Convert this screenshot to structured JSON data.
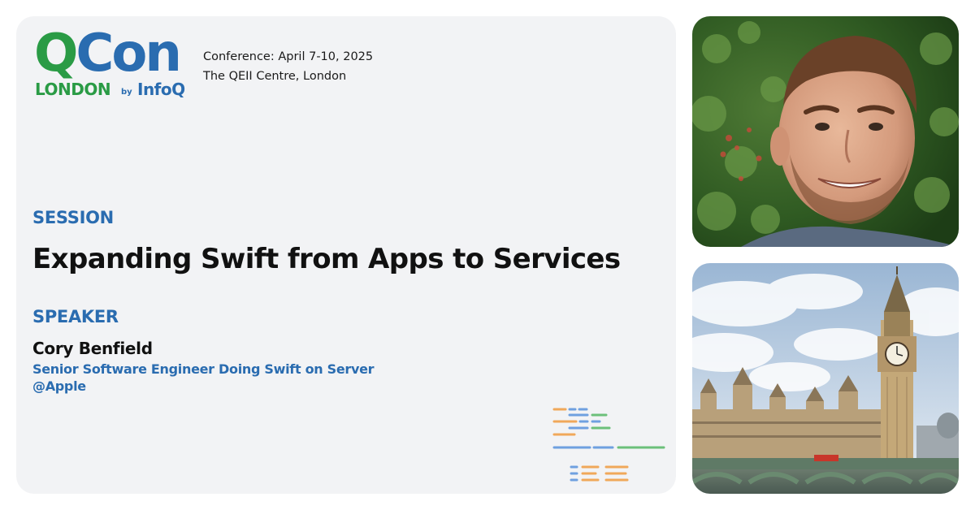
{
  "logo": {
    "q": "Q",
    "con": "Con",
    "city": "LONDON",
    "by": "by",
    "publisher": "InfoQ"
  },
  "conference": {
    "dates": "Conference: April 7-10, 2025",
    "venue": "The QEII Centre, London"
  },
  "session": {
    "label": "SESSION",
    "title": "Expanding Swift from Apps to Services"
  },
  "speaker": {
    "label": "SPEAKER",
    "name": "Cory Benfield",
    "role_line1": "Senior Software Engineer Doing Swift on Server",
    "role_line2": "@Apple"
  },
  "colors": {
    "brand_green": "#2a9b45",
    "brand_blue": "#2a6cb0",
    "card_background": "#f2f3f5",
    "deco_orange": "#f0a85a",
    "deco_blue": "#6fa0e0",
    "deco_green": "#6cc07a"
  },
  "images": {
    "speaker_photo": "speaker-portrait-photo",
    "city_photo": "big-ben-westminster-photo"
  }
}
